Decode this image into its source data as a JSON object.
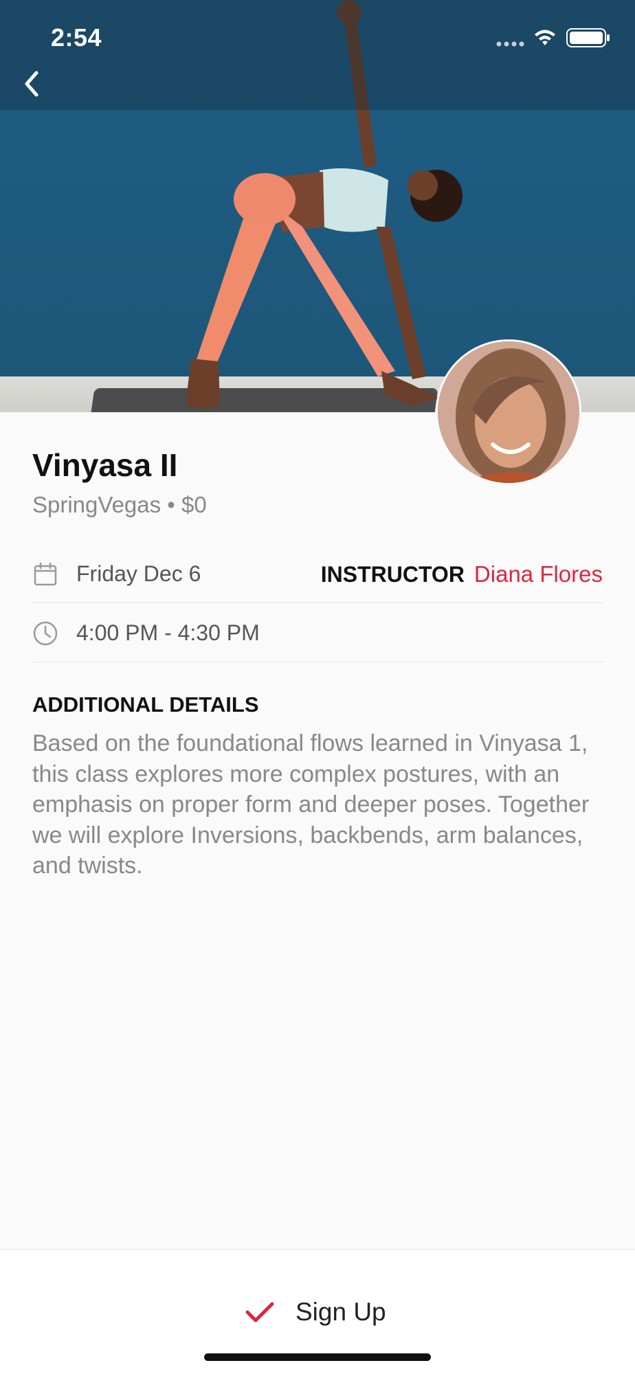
{
  "status_bar": {
    "time": "2:54"
  },
  "class": {
    "title": "Vinyasa II",
    "subtitle": "SpringVegas • $0",
    "date": "Friday Dec 6",
    "time": "4:00 PM - 4:30 PM"
  },
  "instructor": {
    "label": "INSTRUCTOR",
    "name": "Diana Flores"
  },
  "details": {
    "heading": "ADDITIONAL DETAILS",
    "body": "Based on the foundational flows learned in Vinyasa 1, this class explores more complex postures, with an emphasis on proper form and deeper poses. Together we will explore Inversions, backbends, arm balances, and twists."
  },
  "actions": {
    "signup_label": "Sign Up"
  },
  "icons": {
    "back": "chevron-left-icon",
    "calendar": "calendar-icon",
    "clock": "clock-icon",
    "check": "checkmark-icon",
    "wifi": "wifi-icon",
    "battery": "battery-icon"
  },
  "colors": {
    "accent": "#e0243f",
    "hero_bg": "#1e5b80"
  }
}
